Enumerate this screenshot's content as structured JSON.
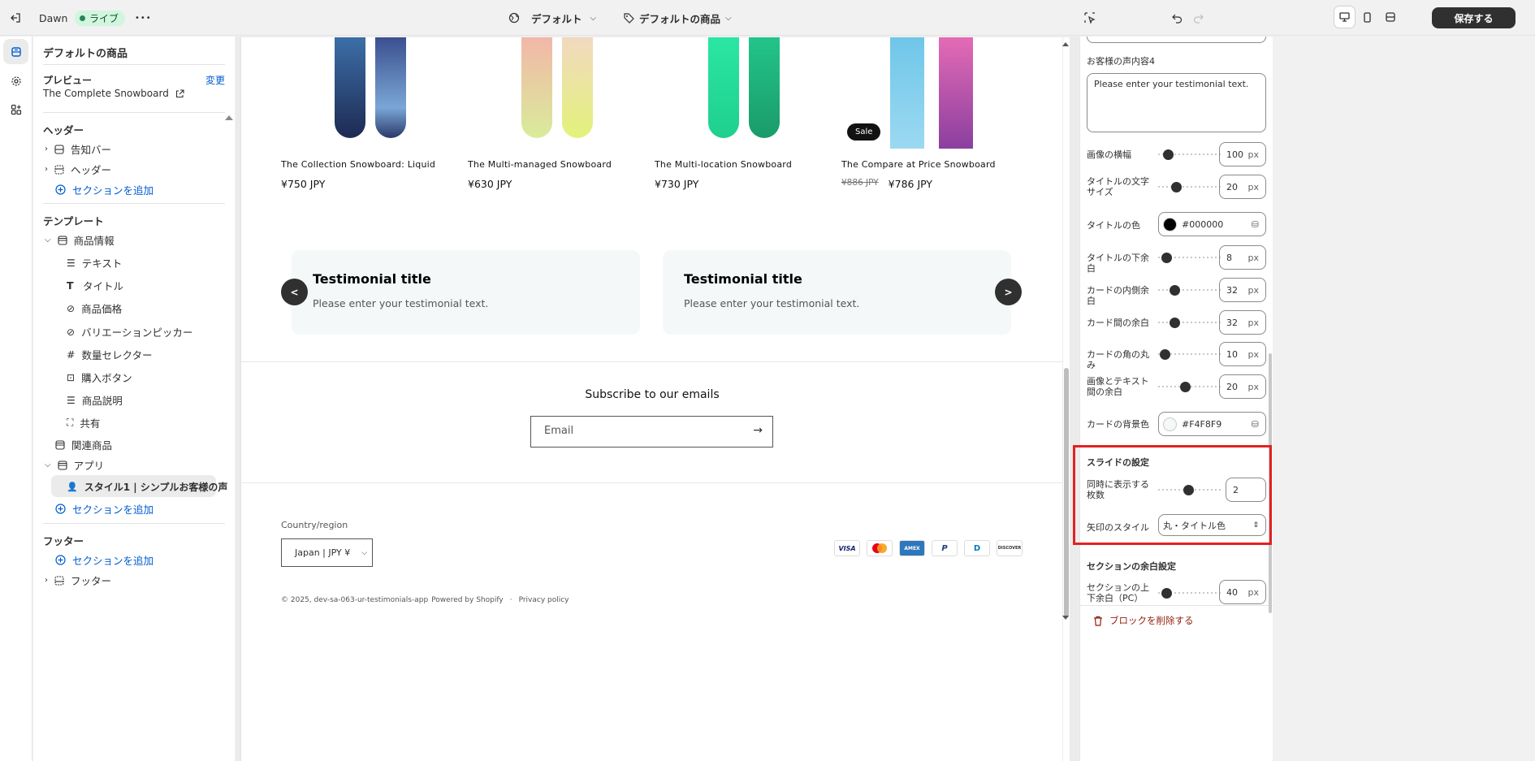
{
  "topbar": {
    "theme_name": "Dawn",
    "live_badge": "ライブ",
    "more": "•••",
    "default_view": "デフォルト",
    "default_product": "デフォルトの商品",
    "save": "保存する"
  },
  "sidebar": {
    "title": "デフォルトの商品",
    "preview_label": "プレビュー",
    "change": "変更",
    "preview_product": "The Complete Snowboard",
    "header_group": "ヘッダー",
    "header_items": [
      "告知バー",
      "ヘッダー"
    ],
    "add_section": "セクションを追加",
    "template_group": "テンプレート",
    "product_info": "商品情報",
    "blocks": [
      "テキスト",
      "タイトル",
      "商品価格",
      "バリエーションピッカー",
      "数量セレクター",
      "購入ボタン",
      "商品説明",
      "共有"
    ],
    "related": "関連商品",
    "apps": "アプリ",
    "app_block": "スタイル1 | シンプルお客様の声",
    "footer_group": "フッター",
    "footer_item": "フッター"
  },
  "preview": {
    "products": [
      {
        "name": "The Collection Snowboard: Liquid",
        "price": "¥750 JPY"
      },
      {
        "name": "The Multi-managed Snowboard",
        "price": "¥630 JPY"
      },
      {
        "name": "The Multi-location Snowboard",
        "price": "¥730 JPY"
      },
      {
        "name": "The Compare at Price Snowboard",
        "compare_price": "¥886 JPY",
        "price": "¥786 JPY"
      }
    ],
    "sale_badge": "Sale",
    "testimonials": [
      {
        "title": "Testimonial title",
        "text": "Please enter your testimonial text."
      },
      {
        "title": "Testimonial title",
        "text": "Please enter your testimonial text."
      }
    ],
    "prev_arrow": "<",
    "next_arrow": ">",
    "subscribe_title": "Subscribe to our emails",
    "email_placeholder": "Email",
    "country_label": "Country/region",
    "country_value": "Japan | JPY ¥",
    "payments": [
      "VISA",
      "MC",
      "AMEX",
      "P",
      "D",
      "DISCOVER"
    ],
    "copyright": "© 2025, dev-sa-063-ur-testimonials-app",
    "powered": "Powered by Shopify",
    "privacy": "Privacy policy"
  },
  "settings": {
    "testimonial4_label": "お客様の声内容4",
    "testimonial4_value": "Please enter your testimonial text.",
    "image_width": {
      "label": "画像の横幅",
      "value": "100",
      "unit": "px"
    },
    "title_font_size": {
      "label": "タイトルの文字サイズ",
      "value": "20",
      "unit": "px"
    },
    "title_color": {
      "label": "タイトルの色",
      "value": "#000000",
      "hex": "#000000"
    },
    "title_bottom": {
      "label": "タイトルの下余白",
      "value": "8",
      "unit": "px"
    },
    "card_padding": {
      "label": "カードの内側余白",
      "value": "32",
      "unit": "px"
    },
    "card_gap": {
      "label": "カード間の余白",
      "value": "32",
      "unit": "px"
    },
    "card_radius": {
      "label": "カードの角の丸み",
      "value": "10",
      "unit": "px"
    },
    "image_text_gap": {
      "label": "画像とテキスト間の余白",
      "value": "20",
      "unit": "px"
    },
    "card_bg": {
      "label": "カードの背景色",
      "value": "#F4F8F9",
      "hex": "#F4F8F9"
    },
    "slide_heading": "スライドの設定",
    "slides_visible": {
      "label": "同時に表示する枚数",
      "value": "2"
    },
    "arrow_style": {
      "label": "矢印のスタイル",
      "value": "丸・タイトル色"
    },
    "section_spacing_heading": "セクションの余白設定",
    "section_padding_pc": {
      "label": "セクションの上下余白（PC）",
      "value": "40",
      "unit": "px"
    },
    "delete_block": "ブロックを削除する"
  }
}
